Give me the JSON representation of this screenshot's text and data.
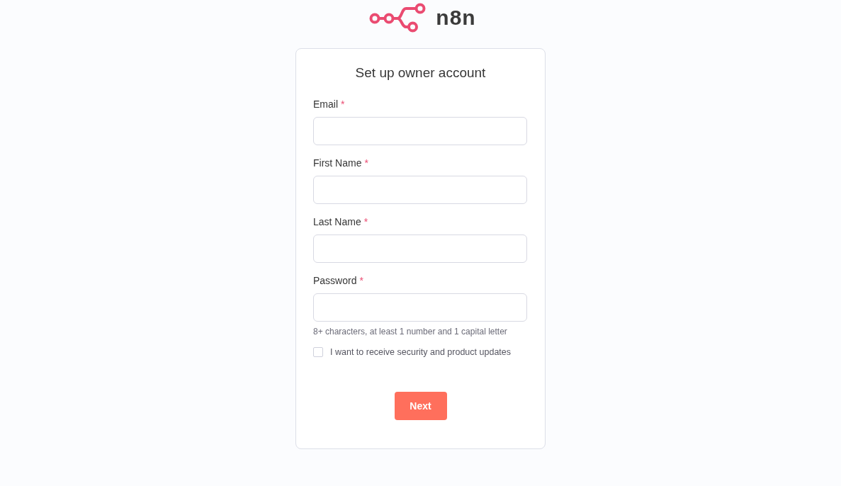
{
  "logo": {
    "wordmark": "n8n"
  },
  "card": {
    "title": "Set up owner account",
    "required_marker": "*",
    "fields": [
      {
        "label": "Email",
        "required": true
      },
      {
        "label": "First Name",
        "required": true
      },
      {
        "label": "Last Name",
        "required": true
      },
      {
        "label": "Password",
        "required": true,
        "hint": "8+ characters, at least 1 number and 1 capital letter"
      }
    ],
    "consent": {
      "label": "I want to receive security and product updates",
      "checked": false
    },
    "button": "Next"
  }
}
